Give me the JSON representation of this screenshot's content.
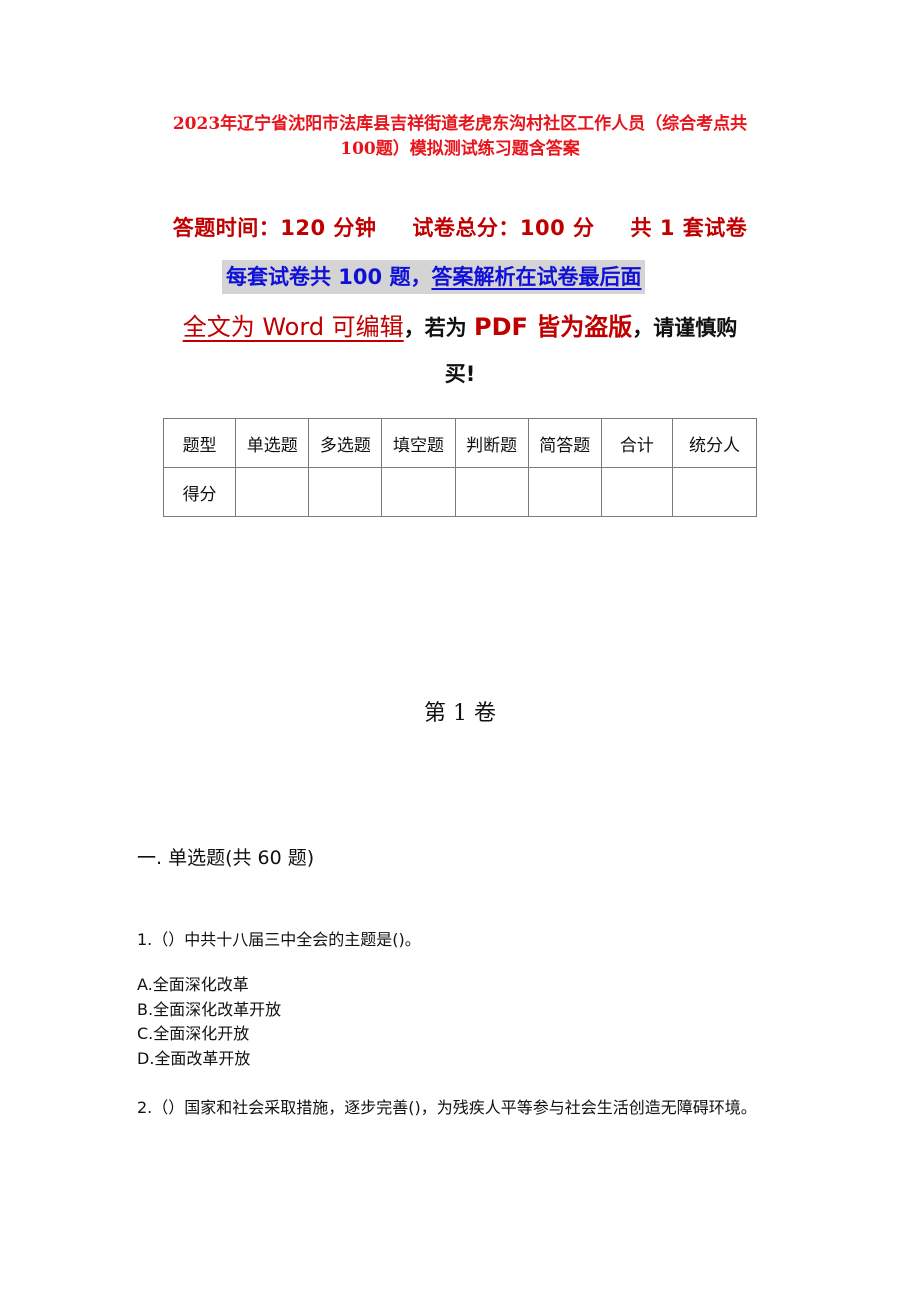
{
  "document": {
    "title_line1": "2023年辽宁省沈阳市法库县吉祥街道老虎东沟村社区工作人员（综合考点共",
    "title_line2": "100题）模拟测试练习题含答案",
    "meta": {
      "time": "答题时间：120 分钟",
      "total_score": "试卷总分：100 分",
      "sets": "共 1 套试卷"
    },
    "notice": {
      "part1": "每套试卷共 100 题，",
      "part2": "答案解析在试卷最后面"
    },
    "warning": {
      "part1": "全文为 Word 可编辑",
      "part2": "，若为 ",
      "part3": "PDF 皆为盗版",
      "part4": "，请谨慎购",
      "line2": "买!"
    },
    "score_table": {
      "header": [
        "题型",
        "单选题",
        "多选题",
        "填空题",
        "判断题",
        "简答题",
        "合计",
        "统分人"
      ],
      "row": [
        "得分",
        "",
        "",
        "",
        "",
        "",
        "",
        ""
      ]
    },
    "volume_title": "第 1 卷",
    "section_title": "一. 单选题(共 60 题)",
    "questions": [
      {
        "text": "1.（）中共十八届三中全会的主题是()。",
        "options": [
          "A.全面深化改革",
          "B.全面深化改革开放",
          "C.全面深化开放",
          "D.全面改革开放"
        ]
      },
      {
        "text": "2.（）国家和社会采取措施，逐步完善()，为残疾人平等参与社会生活创造无障碍环境。"
      }
    ]
  }
}
